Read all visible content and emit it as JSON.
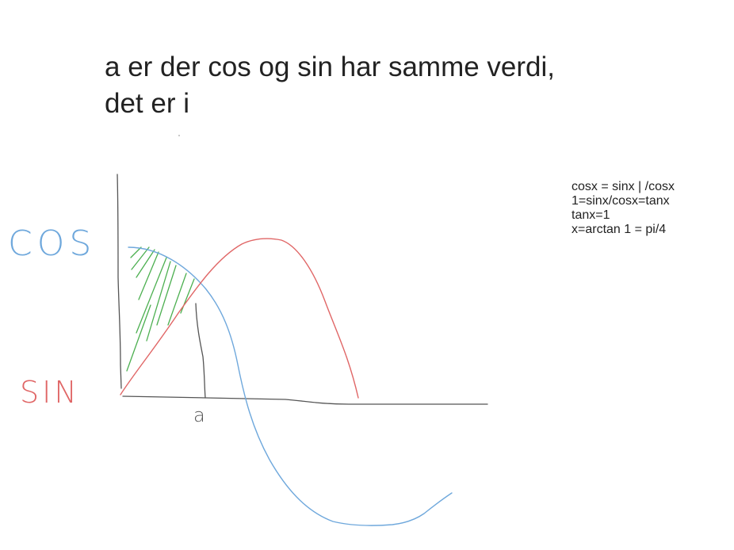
{
  "heading": {
    "line1": "a er der cos og sin har samme verdi,",
    "line2": "det er i"
  },
  "notes": [
    "cosx = sinx | /cosx",
    "1=sinx/cosx=tanx",
    "tanx=1",
    "x=arctan 1 = pi/4"
  ],
  "sketch": {
    "cos_label": "COS",
    "sin_label": "SIN",
    "intersection_label": "a",
    "colors": {
      "cos": "#6fa8dc",
      "sin": "#e06666",
      "hatch": "#4caf50",
      "axes": "#555555"
    }
  }
}
